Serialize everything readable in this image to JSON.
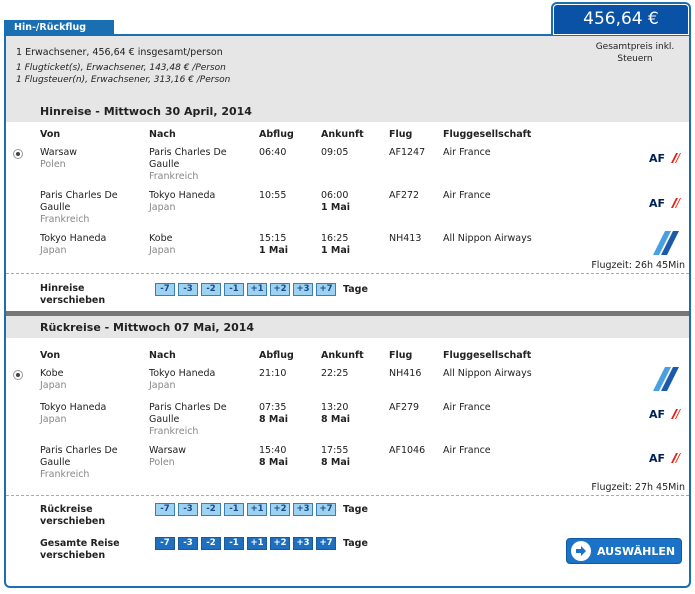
{
  "tab_label": "Hin-/Rückflug",
  "price": "456,64 €",
  "summary": {
    "line1": "1 Erwachsener, 456,64 € insgesamt/person",
    "line2": "1 Flugticket(s), Erwachsener, 143,48 € /Person",
    "line3": "1 Flugsteuer(n), Erwachsener, 313,16 € /Person",
    "total_note_1": "Gesamtpreis inkl.",
    "total_note_2": "Steuern"
  },
  "columns": {
    "von": "Von",
    "nach": "Nach",
    "abflug": "Abflug",
    "ankunft": "Ankunft",
    "flug": "Flug",
    "airline": "Fluggesellschaft"
  },
  "outbound": {
    "title": "Hinreise - Mittwoch 30 April, 2014",
    "flight_time": "Flugzeit: 26h 45Min",
    "shift_label_1": "Hinreise",
    "shift_label_2": "verschieben",
    "segments": [
      {
        "from": "Warsaw",
        "from_country": "Polen",
        "to_1": "Paris Charles De",
        "to_2": "Gaulle",
        "to_country": "Frankreich",
        "dep": "06:40",
        "arr": "09:05",
        "arr_day": "",
        "dep_day": "",
        "flight": "AF1247",
        "airline": "Air France",
        "logo": "air-france-logo"
      },
      {
        "from_1": "Paris Charles De",
        "from_2": "Gaulle",
        "from_country": "Frankreich",
        "to": "Tokyo Haneda",
        "to_country": "Japan",
        "dep": "10:55",
        "arr": "06:00",
        "arr_day": "1 Mai",
        "flight": "AF272",
        "airline": "Air France",
        "logo": "air-france-logo"
      },
      {
        "from": "Tokyo Haneda",
        "from_country": "Japan",
        "to": "Kobe",
        "to_country": "Japan",
        "dep": "15:15",
        "dep_day": "1 Mai",
        "arr": "16:25",
        "arr_day": "1 Mai",
        "flight": "NH413",
        "airline": "All Nippon Airways",
        "logo": "ana-logo"
      }
    ]
  },
  "return": {
    "title": "Rückreise - Mittwoch 07 Mai, 2014",
    "flight_time": "Flugzeit: 27h 45Min",
    "shift_label_1": "Rückreise",
    "shift_label_2": "verschieben",
    "segments": [
      {
        "from": "Kobe",
        "from_country": "Japan",
        "to": "Tokyo Haneda",
        "to_country": "Japan",
        "dep": "21:10",
        "arr": "22:25",
        "flight": "NH416",
        "airline": "All Nippon Airways",
        "logo": "ana-logo"
      },
      {
        "from": "Tokyo Haneda",
        "from_country": "Japan",
        "to_1": "Paris Charles De",
        "to_2": "Gaulle",
        "to_country": "Frankreich",
        "dep": "07:35",
        "dep_day": "8 Mai",
        "arr": "13:20",
        "arr_day": "8 Mai",
        "flight": "AF279",
        "airline": "Air France",
        "logo": "air-france-logo"
      },
      {
        "from_1": "Paris Charles De",
        "from_2": "Gaulle",
        "from_country": "Frankreich",
        "to": "Warsaw",
        "to_country": "Polen",
        "dep": "15:40",
        "dep_day": "8 Mai",
        "arr": "17:55",
        "arr_day": "8 Mai",
        "flight": "AF1046",
        "airline": "Air France",
        "logo": "air-france-logo"
      }
    ]
  },
  "total_shift_label_1": "Gesamte Reise",
  "total_shift_label_2": "verschieben",
  "shift_options": [
    "-7",
    "-3",
    "-2",
    "-1",
    "+1",
    "+2",
    "+3",
    "+7"
  ],
  "tage": "Tage",
  "select_button": "AUSWÄHLEN",
  "colors": {
    "brand_blue": "#1a6fb3",
    "price_bg": "#0a52a5",
    "chip_light": "#9dd3f0",
    "chip_dark": "#1f6fbf",
    "af_red": "#e2231a",
    "af_blue": "#002157"
  }
}
